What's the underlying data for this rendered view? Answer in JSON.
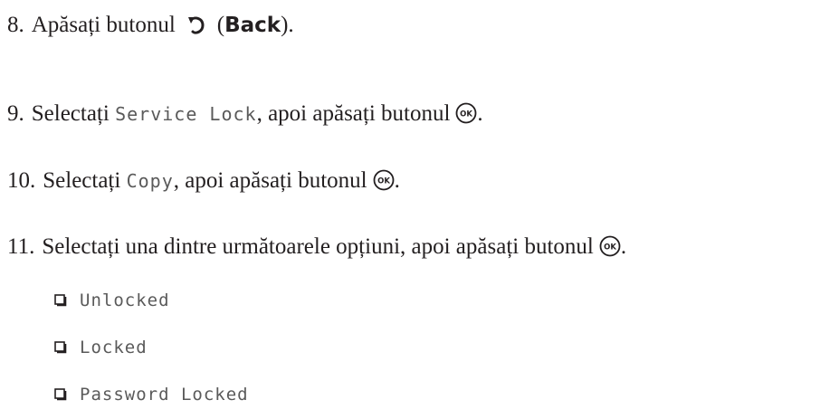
{
  "steps": [
    {
      "number": "8.",
      "text_before_icon": "Apăsați butonul",
      "icon": "back-arrow-icon",
      "button_name": "Back",
      "text_after": ")."
    },
    {
      "number": "9.",
      "text_before": "Selectați ",
      "lcd_text": "Service Lock",
      "text_after_lcd": ", apoi apăsați butonul",
      "icon": "ok-button-icon",
      "text_end": "."
    },
    {
      "number": "10.",
      "text_before": "Selectați ",
      "lcd_text": "Copy",
      "text_after_lcd": ", apoi apăsați butonul",
      "icon": "ok-button-icon",
      "text_end": "."
    },
    {
      "number": "11.",
      "text_before": "Selectați una dintre următoarele opțiuni, apoi apăsați butonul",
      "icon": "ok-button-icon",
      "text_end": "."
    }
  ],
  "options": [
    {
      "label": "Unlocked"
    },
    {
      "label": "Locked"
    },
    {
      "label": "Password Locked"
    }
  ],
  "ok_icon_text": "OK",
  "colors": {
    "text": "#231f20",
    "lcd_text": "#5a5a5a"
  }
}
